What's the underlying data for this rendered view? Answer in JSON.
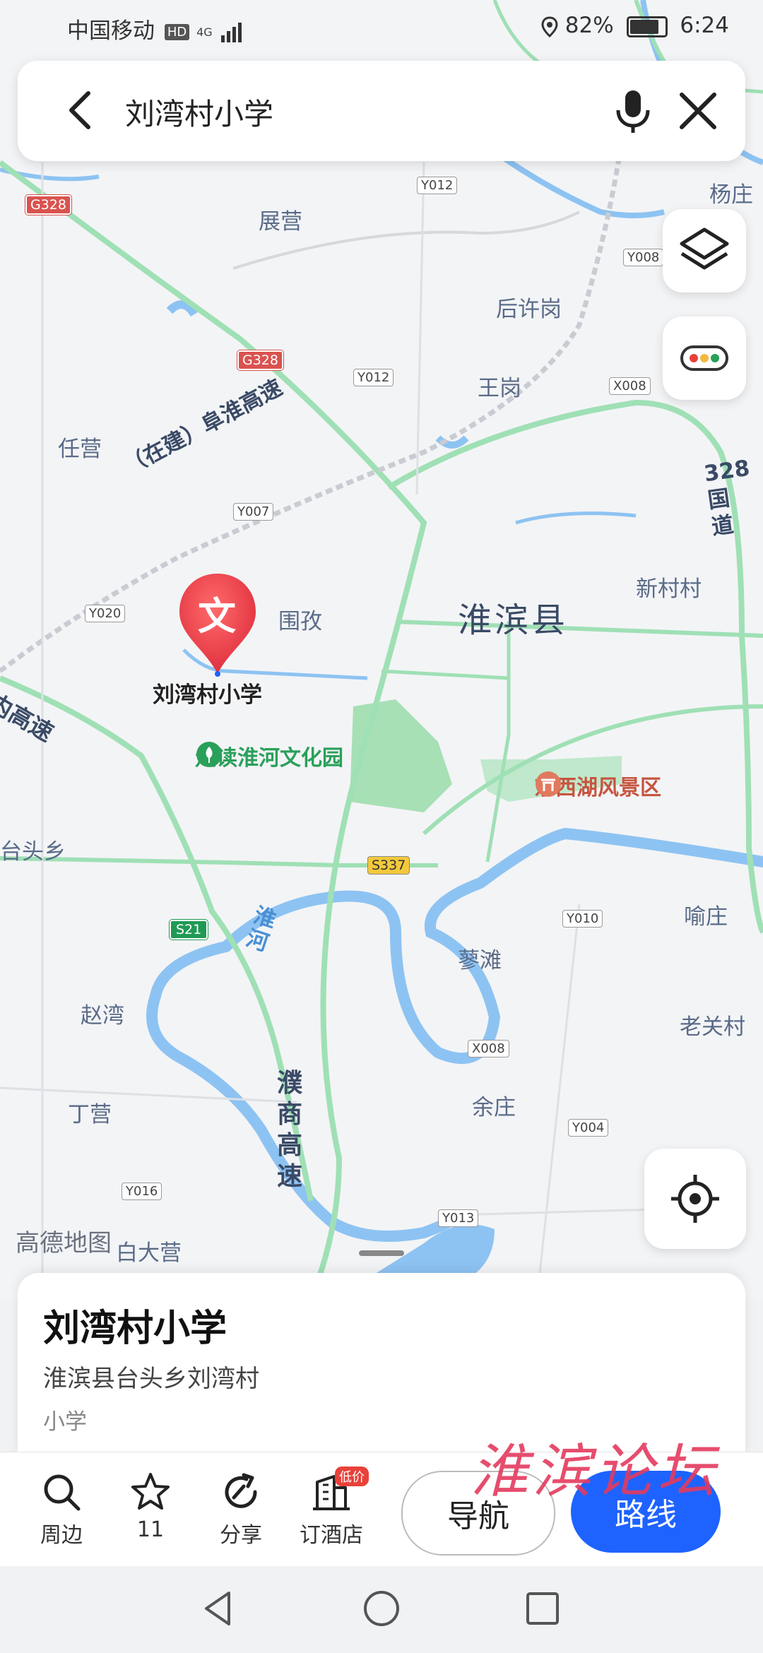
{
  "status_bar": {
    "carrier": "中国移动",
    "hd": "HD",
    "network": "4G",
    "battery": "82%",
    "time": "6:24"
  },
  "search": {
    "query": "刘湾村小学"
  },
  "map": {
    "places": [
      {
        "id": "zhanying",
        "name": "展营"
      },
      {
        "id": "houxugang",
        "name": "后许岗"
      },
      {
        "id": "wanggang",
        "name": "王岗"
      },
      {
        "id": "renying",
        "name": "任营"
      },
      {
        "id": "weimei",
        "name": "围孜"
      },
      {
        "id": "huaibin",
        "name": "淮滨县"
      },
      {
        "id": "xincuncun",
        "name": "新村村"
      },
      {
        "id": "taitouxiang",
        "name": "台头乡"
      },
      {
        "id": "lutan",
        "name": "蓼滩"
      },
      {
        "id": "yuzhuang",
        "name": "喻庄"
      },
      {
        "id": "zhaowan",
        "name": "赵湾"
      },
      {
        "id": "laoguancun",
        "name": "老关村"
      },
      {
        "id": "dingying",
        "name": "丁营"
      },
      {
        "id": "yuzhuang2",
        "name": "余庄"
      },
      {
        "id": "dadaying",
        "name": "白大营"
      },
      {
        "id": "yangzhuang",
        "name": "杨庄"
      }
    ],
    "roads": {
      "y012a": "Y012",
      "y012b": "Y012",
      "y008": "Y008",
      "x008a": "X008",
      "y007": "Y007",
      "y020": "Y020",
      "y010": "Y010",
      "x008b": "X008",
      "y004": "Y004",
      "y016": "Y016",
      "y013": "Y013",
      "g328a": "G328",
      "g328b": "G328",
      "s337": "S337",
      "s21": "S21"
    },
    "highway_labels": {
      "fuhuai": "（在建）阜淮高速",
      "guodao": "328国道",
      "puShang": "濮商高速",
      "neiGaosu": "内高速",
      "huaihe": "淮河"
    },
    "pois": {
      "park": "走读淮河文化园",
      "scenic": "东西湖风景区"
    },
    "logo": "高德地图",
    "selected_marker": {
      "glyph": "文",
      "label": "刘湾村小学"
    }
  },
  "place_card": {
    "title": "刘湾村小学",
    "address": "淮滨县台头乡刘湾村",
    "category": "小学"
  },
  "actions": [
    {
      "id": "nearby",
      "label": "周边",
      "icon": "search-icon"
    },
    {
      "id": "favorite",
      "label": "11",
      "icon": "star-icon"
    },
    {
      "id": "share",
      "label": "分享",
      "icon": "share-icon"
    },
    {
      "id": "hotel",
      "label": "订酒店",
      "icon": "hotel-icon",
      "badge": "低价"
    }
  ],
  "buttons": {
    "navigate": "导航",
    "route": "路线"
  },
  "watermark": "淮滨论坛",
  "colors": {
    "accent_blue": "#1e63ff",
    "river": "#8dc3f2",
    "road_green": "#9fe0b5",
    "marker_red": "#e8413a"
  }
}
